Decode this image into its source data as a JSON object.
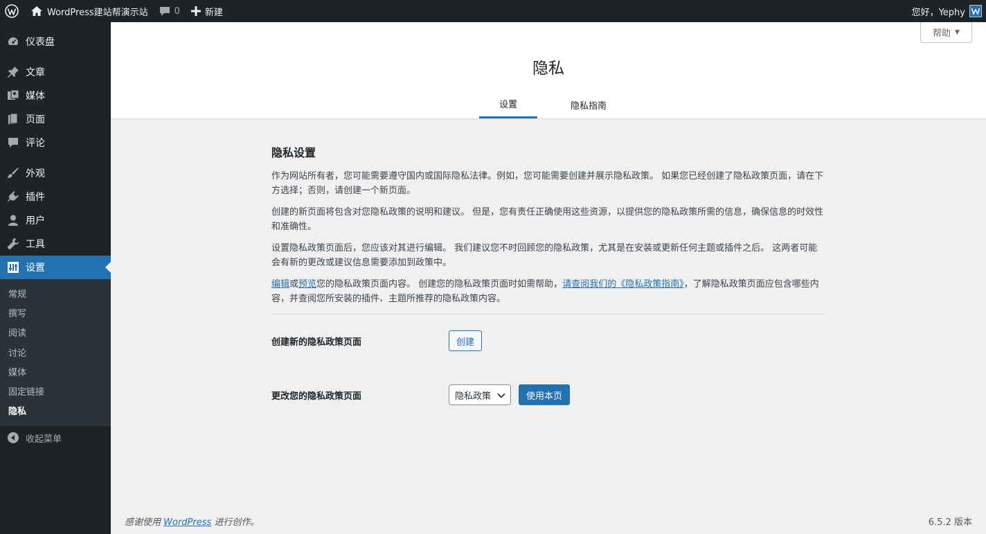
{
  "adminbar": {
    "site_name": "WordPress建站帮演示站",
    "comments_count": "0",
    "new_label": "新建",
    "greeting": "您好，Yephy"
  },
  "sidebar": {
    "items": [
      {
        "label": "仪表盘",
        "icon": "dashboard-icon"
      },
      {
        "label": "文章",
        "icon": "pin-icon"
      },
      {
        "label": "媒体",
        "icon": "media-icon"
      },
      {
        "label": "页面",
        "icon": "page-icon"
      },
      {
        "label": "评论",
        "icon": "comment-icon"
      },
      {
        "label": "外观",
        "icon": "brush-icon"
      },
      {
        "label": "插件",
        "icon": "plugin-icon"
      },
      {
        "label": "用户",
        "icon": "user-icon"
      },
      {
        "label": "工具",
        "icon": "wrench-icon"
      },
      {
        "label": "设置",
        "icon": "settings-icon"
      }
    ],
    "submenu": [
      "常规",
      "撰写",
      "阅读",
      "讨论",
      "媒体",
      "固定链接",
      "隐私"
    ],
    "collapse_label": "收起菜单"
  },
  "header": {
    "help_label": "帮助",
    "title": "隐私",
    "tabs": [
      "设置",
      "隐私指南"
    ]
  },
  "main": {
    "section_title": "隐私设置",
    "para1": "作为网站所有者，您可能需要遵守国内或国际隐私法律。例如，您可能需要创建并展示隐私政策。 如果您已经创建了隐私政策页面，请在下方选择；否则，请创建一个新页面。",
    "para2": "创建的新页面将包含对您隐私政策的说明和建议。 但是，您有责任正确使用这些资源，以提供您的隐私政策所需的信息，确保信息的时效性和准确性。",
    "para3": "设置隐私政策页面后，您应该对其进行编辑。 我们建议您不时回顾您的隐私政策，尤其是在安装或更新任何主题或插件之后。 这两者可能会有新的更改或建议信息需要添加到政策中。",
    "para4": {
      "edit_link": "编辑",
      "or": "或",
      "preview_link": "预览",
      "text1": "您的隐私政策页面内容。 创建您的隐私政策页面时如需帮助，",
      "guide_link": "请查阅我们的《隐私政策指南》",
      "text2": "，了解隐私政策页面应包含哪些内容，并查阅您所安装的插件、主题所推荐的隐私政策内容。"
    },
    "create_row_label": "创建新的隐私政策页面",
    "create_button": "创建",
    "change_row_label": "更改您的隐私政策页面",
    "select_value": "隐私政策",
    "use_button": "使用本页"
  },
  "footer": {
    "thanks_prefix": "感谢使用 ",
    "wordpress_link": "WordPress",
    "thanks_suffix": " 进行创作。",
    "version": "6.5.2 版本"
  },
  "colors": {
    "adminbar_bg": "#1d2327",
    "accent": "#2271b1",
    "page_bg": "#f0f0f1"
  }
}
